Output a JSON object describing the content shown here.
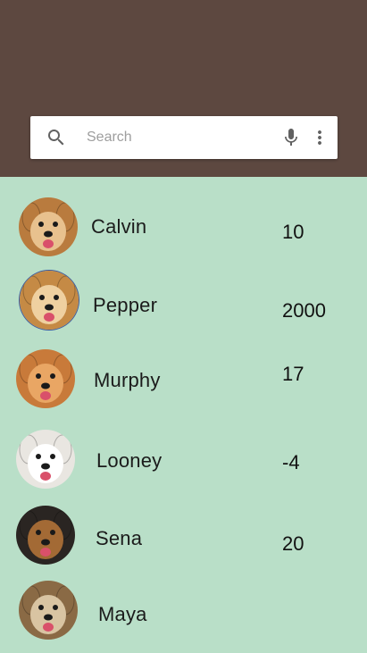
{
  "colors": {
    "header": "#5d4840",
    "list_background": "#b9dfc8"
  },
  "search": {
    "placeholder": "Search",
    "icons": [
      "search-icon",
      "mic-icon",
      "more-vert-icon"
    ]
  },
  "dogs": [
    {
      "name": "Calvin",
      "score": "10",
      "fur": "#b97b3e",
      "face": "#e8c18e"
    },
    {
      "name": "Pepper",
      "score": "2000",
      "fur": "#c58a45",
      "face": "#efd0a0"
    },
    {
      "name": "Murphy",
      "score": "17",
      "fur": "#c87a3a",
      "face": "#e9a664"
    },
    {
      "name": "Looney",
      "score": "-4",
      "fur": "#e9e6e1",
      "face": "#ffffff"
    },
    {
      "name": "Sena",
      "score": "20",
      "fur": "#2a2522",
      "face": "#a36a35"
    },
    {
      "name": "Maya",
      "score": "",
      "fur": "#8a6a45",
      "face": "#d9c4a2"
    }
  ]
}
